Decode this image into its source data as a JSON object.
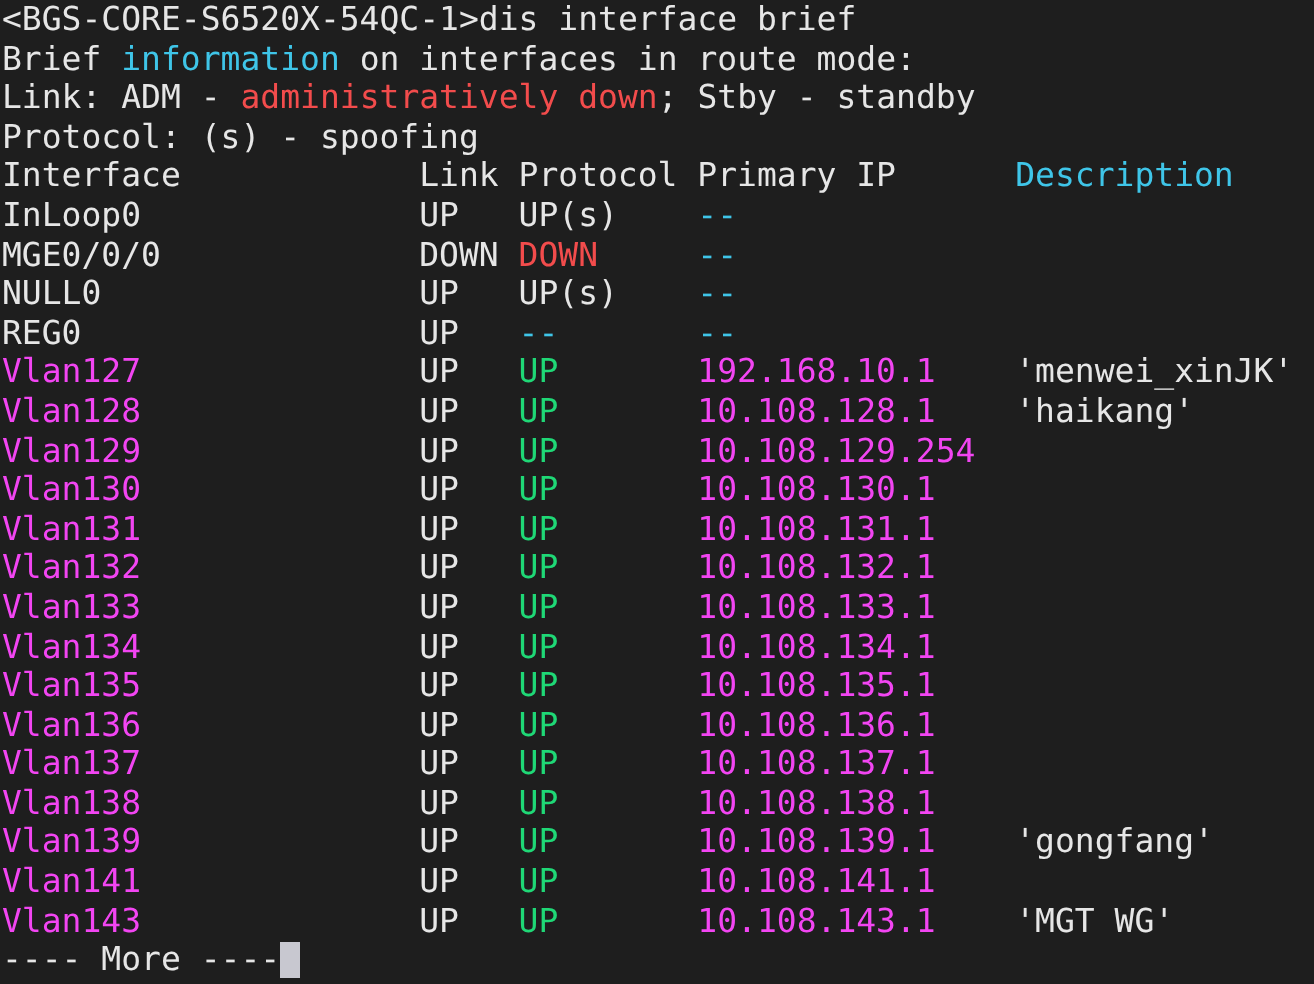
{
  "terminal": {
    "intro_lines": [
      {
        "segments": [
          {
            "text": "<BGS-CORE-S6520X-54QC-1>dis interface brief",
            "color": "#e6e6e6"
          }
        ]
      },
      {
        "segments": [
          {
            "text": "Brief ",
            "color": "#e6e6e6"
          },
          {
            "text": "information",
            "color": "#3fc5e8"
          },
          {
            "text": " on interfaces in route mode:",
            "color": "#e6e6e6"
          }
        ]
      },
      {
        "segments": [
          {
            "text": "Link: ADM - ",
            "color": "#e6e6e6"
          },
          {
            "text": "administratively down",
            "color": "#f24c4c"
          },
          {
            "text": "; Stby - standby",
            "color": "#e6e6e6"
          }
        ]
      },
      {
        "segments": [
          {
            "text": "Protocol: (s) - spoofing",
            "color": "#e6e6e6"
          }
        ]
      }
    ],
    "table": {
      "columns": [
        {
          "label": "Interface",
          "color": "#e6e6e6"
        },
        {
          "label": "Link",
          "color": "#e6e6e6"
        },
        {
          "label": "Protocol",
          "color": "#e6e6e6"
        },
        {
          "label": "Primary IP",
          "color": "#e6e6e6"
        },
        {
          "label": "Description",
          "color": "#3fc5e8"
        }
      ],
      "rows": [
        {
          "kind": "system",
          "interface": "InLoop0",
          "link": "UP",
          "protocol": {
            "text": "UP(s)",
            "color": "#e6e6e6"
          },
          "primary_ip": "--"
        },
        {
          "kind": "system",
          "interface": "MGE0/0/0",
          "link": "DOWN",
          "protocol": {
            "text": "DOWN",
            "color": "#f24c4c"
          },
          "primary_ip": "--"
        },
        {
          "kind": "system",
          "interface": "NULL0",
          "link": "UP",
          "protocol": {
            "text": "UP(s)",
            "color": "#e6e6e6"
          },
          "primary_ip": "--"
        },
        {
          "kind": "system",
          "interface": "REG0",
          "link": "UP",
          "protocol": {
            "text": "--",
            "color": "#3fc5e8"
          },
          "primary_ip": "--"
        },
        {
          "kind": "vlan",
          "interface": "Vlan127",
          "link": "UP",
          "protocol": {
            "text": "UP",
            "color": "#1fd876"
          },
          "primary_ip": "192.168.10.1",
          "description": "'menwei_xinJK'"
        },
        {
          "kind": "vlan",
          "interface": "Vlan128",
          "link": "UP",
          "protocol": {
            "text": "UP",
            "color": "#1fd876"
          },
          "primary_ip": "10.108.128.1",
          "description": "'haikang'"
        },
        {
          "kind": "vlan",
          "interface": "Vlan129",
          "link": "UP",
          "protocol": {
            "text": "UP",
            "color": "#1fd876"
          },
          "primary_ip": "10.108.129.254"
        },
        {
          "kind": "vlan",
          "interface": "Vlan130",
          "link": "UP",
          "protocol": {
            "text": "UP",
            "color": "#1fd876"
          },
          "primary_ip": "10.108.130.1"
        },
        {
          "kind": "vlan",
          "interface": "Vlan131",
          "link": "UP",
          "protocol": {
            "text": "UP",
            "color": "#1fd876"
          },
          "primary_ip": "10.108.131.1"
        },
        {
          "kind": "vlan",
          "interface": "Vlan132",
          "link": "UP",
          "protocol": {
            "text": "UP",
            "color": "#1fd876"
          },
          "primary_ip": "10.108.132.1"
        },
        {
          "kind": "vlan",
          "interface": "Vlan133",
          "link": "UP",
          "protocol": {
            "text": "UP",
            "color": "#1fd876"
          },
          "primary_ip": "10.108.133.1"
        },
        {
          "kind": "vlan",
          "interface": "Vlan134",
          "link": "UP",
          "protocol": {
            "text": "UP",
            "color": "#1fd876"
          },
          "primary_ip": "10.108.134.1"
        },
        {
          "kind": "vlan",
          "interface": "Vlan135",
          "link": "UP",
          "protocol": {
            "text": "UP",
            "color": "#1fd876"
          },
          "primary_ip": "10.108.135.1"
        },
        {
          "kind": "vlan",
          "interface": "Vlan136",
          "link": "UP",
          "protocol": {
            "text": "UP",
            "color": "#1fd876"
          },
          "primary_ip": "10.108.136.1"
        },
        {
          "kind": "vlan",
          "interface": "Vlan137",
          "link": "UP",
          "protocol": {
            "text": "UP",
            "color": "#1fd876"
          },
          "primary_ip": "10.108.137.1"
        },
        {
          "kind": "vlan",
          "interface": "Vlan138",
          "link": "UP",
          "protocol": {
            "text": "UP",
            "color": "#1fd876"
          },
          "primary_ip": "10.108.138.1"
        },
        {
          "kind": "vlan",
          "interface": "Vlan139",
          "link": "UP",
          "protocol": {
            "text": "UP",
            "color": "#1fd876"
          },
          "primary_ip": "10.108.139.1",
          "description": "'gongfang'"
        },
        {
          "kind": "vlan",
          "interface": "Vlan141",
          "link": "UP",
          "protocol": {
            "text": "UP",
            "color": "#1fd876"
          },
          "primary_ip": "10.108.141.1"
        },
        {
          "kind": "vlan",
          "interface": "Vlan143",
          "link": "UP",
          "protocol": {
            "text": "UP",
            "color": "#1fd876"
          },
          "primary_ip": "10.108.143.1",
          "description": "'MGT WG'"
        }
      ]
    },
    "pager_prompt": "---- More ----"
  }
}
